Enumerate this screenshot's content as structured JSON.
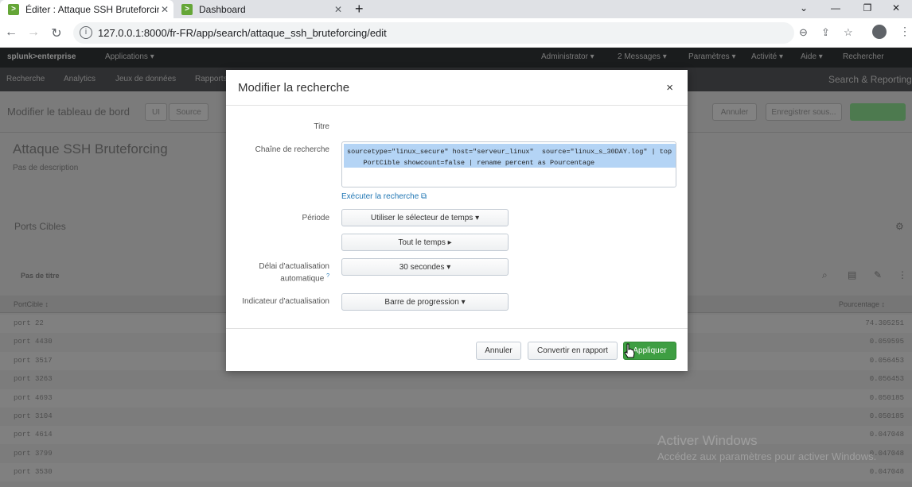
{
  "browser": {
    "tabs": [
      {
        "title": "Éditer : Attaque SSH Bruteforcing",
        "active": true
      },
      {
        "title": "Dashboard",
        "active": false
      }
    ],
    "url": "127.0.0.1:8000/fr-FR/app/search/attaque_ssh_bruteforcing/edit"
  },
  "splunk": {
    "logo": "splunk>enterprise",
    "top_menu": [
      "Applications ▾",
      "Administrator ▾",
      "2 Messages ▾",
      "Paramètres ▾",
      "Activité ▾",
      "Aide ▾",
      "Rechercher"
    ],
    "app_nav": [
      "Recherche",
      "Analytics",
      "Jeux de données",
      "Rapports"
    ],
    "app_name": "Search & Reporting",
    "edit_title": "Modifier le tableau de bord",
    "edit_toggle": [
      "UI",
      "Source"
    ],
    "edit_buttons": [
      "Annuler",
      "Enregistrer sous..."
    ],
    "dashboard_title": "Attaque SSH Bruteforcing",
    "dashboard_desc": "Pas de description",
    "panel_title": "Ports Cibles",
    "panel_subtitle": "Pas de titre",
    "table_headers": [
      "PortCible ↕",
      "Pourcentage ↕"
    ],
    "table_rows": [
      {
        "port": "port 22",
        "pct": "74.305251"
      },
      {
        "port": "port 4430",
        "pct": "0.059595"
      },
      {
        "port": "port 3517",
        "pct": "0.056453"
      },
      {
        "port": "port 3263",
        "pct": "0.056453"
      },
      {
        "port": "port 4693",
        "pct": "0.050185"
      },
      {
        "port": "port 3104",
        "pct": "0.050185"
      },
      {
        "port": "port 4614",
        "pct": "0.047048"
      },
      {
        "port": "port 3799",
        "pct": "0.047048"
      },
      {
        "port": "port 3530",
        "pct": "0.047048"
      }
    ]
  },
  "modal": {
    "title": "Modifier la recherche",
    "close": "×",
    "labels": {
      "titre": "Titre",
      "chaine": "Chaîne de recherche",
      "periode": "Période",
      "delai1": "Délai d'actualisation",
      "delai2": "automatique",
      "help": "?",
      "indicateur": "Indicateur d'actualisation"
    },
    "search_line1": "sourcetype=\"linux_secure\" host=\"serveur_linux\"  source=\"linux_s_30DAY.log\" | top",
    "search_line2": "    PortCible showcount=false | rename percent as Pourcentage",
    "run_link": "Exécuter la recherche ⧉",
    "dropdowns": {
      "time_picker": "Utiliser le sélecteur de temps ▾",
      "all_time": "Tout le temps ▸",
      "refresh": "30 secondes ▾",
      "indicator": "Barre de progression ▾"
    },
    "footer": {
      "cancel": "Annuler",
      "convert": "Convertir en rapport",
      "apply": "Appliquer"
    }
  },
  "watermark": {
    "line1": "Activer Windows",
    "line2": "Accédez aux paramètres pour activer Windows."
  },
  "colors": {
    "accent_green": "#3e9e42",
    "link_blue": "#1e75b3",
    "selection": "#b4d4f5"
  }
}
